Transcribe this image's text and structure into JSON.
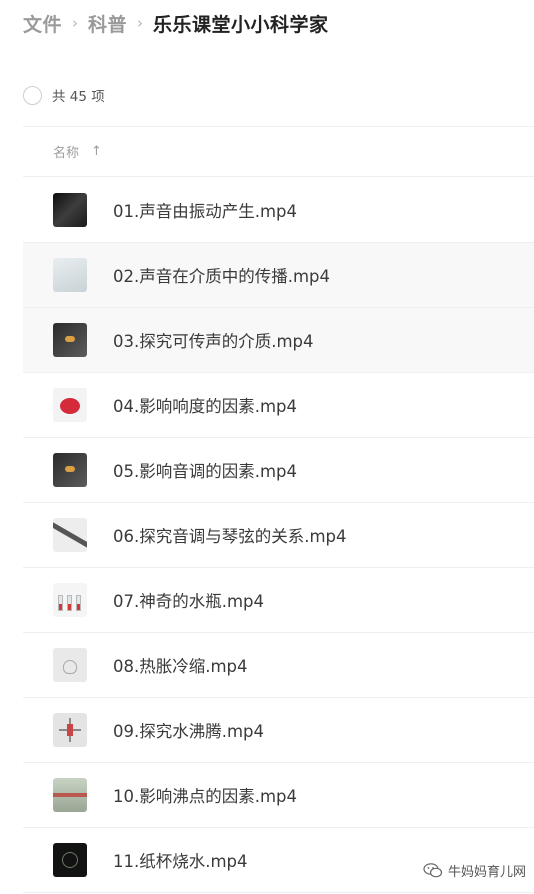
{
  "breadcrumb": {
    "items": [
      "文件",
      "科普"
    ],
    "current": "乐乐课堂小小科学家",
    "separator": "›"
  },
  "summary": {
    "count_text": "共 45 项"
  },
  "columns": {
    "name_label": "名称",
    "sort_arrow": "↑"
  },
  "files": [
    {
      "name": "01.声音由振动产生.mp4",
      "thumb": "dark-video-thumbnail"
    },
    {
      "name": "02.声音在介质中的传播.mp4",
      "thumb": "light-video-thumbnail"
    },
    {
      "name": "03.探究可传声的介质.mp4",
      "thumb": "gray-video-thumbnail"
    },
    {
      "name": "04.影响响度的因素.mp4",
      "thumb": "red-ball-video-thumbnail"
    },
    {
      "name": "05.影响音调的因素.mp4",
      "thumb": "gray-video-thumbnail"
    },
    {
      "name": "06.探究音调与琴弦的关系.mp4",
      "thumb": "string-video-thumbnail"
    },
    {
      "name": "07.神奇的水瓶.mp4",
      "thumb": "bottles-video-thumbnail"
    },
    {
      "name": "08.热胀冷缩.mp4",
      "thumb": "glass-video-thumbnail"
    },
    {
      "name": "09.探究水沸腾.mp4",
      "thumb": "boiling-video-thumbnail"
    },
    {
      "name": "10.影响沸点的因素.mp4",
      "thumb": "field-video-thumbnail"
    },
    {
      "name": "11.纸杯烧水.mp4",
      "thumb": "cup-video-thumbnail"
    }
  ],
  "watermark": {
    "text": "牛妈妈育儿网",
    "icon": "wechat-icon"
  }
}
